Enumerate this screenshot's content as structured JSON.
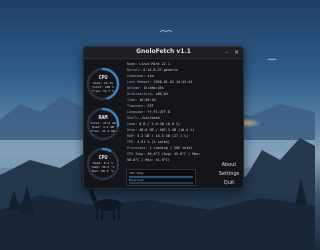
{
  "window": {
    "title": "GnoloFetch v1.1",
    "minimize_label": "–",
    "close_label": "✕"
  },
  "gauges": [
    {
      "title": "CPU",
      "lines": [
        "Used: 45.3%",
        "Total: 100 %",
        "Free: 54.7 %"
      ],
      "value": 0.45,
      "color": "#3b82c4"
    },
    {
      "title": "RAM",
      "lines": [
        "Total: 15.5 GB",
        "Used: 4.2 GB",
        "Free: 11.3 GB"
      ],
      "value": 0.27,
      "color": "#3b82c4"
    },
    {
      "title": "CPU",
      "lines": [
        "Used: 8.1 %",
        "Temp: 46.0 °C",
        "Max: 80.0 °C"
      ],
      "value": 0.08,
      "color": "#3b82c4"
    }
  ],
  "info": [
    {
      "key": "Name:",
      "value": "Linux Mint 22.1"
    },
    {
      "key": "Kernel:",
      "value": "6.14.0-37-generic"
    },
    {
      "key": "Codename:",
      "value": "xia"
    },
    {
      "key": "Last Reboot:",
      "value": "2026-01-02 14:45:44"
    },
    {
      "key": "Uptime:",
      "value": "1h:46m:45s"
    },
    {
      "key": "Architecture:",
      "value": "x86_64"
    },
    {
      "key": "Time:",
      "value": "16:36:26"
    },
    {
      "key": "Timezone:",
      "value": "EST"
    },
    {
      "key": "Language:",
      "value": "fr_FI.UTF-8"
    },
    {
      "key": "Shell:",
      "value": "/bin/bash"
    },
    {
      "key": "Swap:",
      "value": "0 B / 2.0 GB (0.0 %)"
    },
    {
      "key": "Disk:",
      "value": "48.6 GB / 467.3 GB (10.4 %)"
    },
    {
      "key": "RAM:",
      "value": "4.2 GB / 15.5 GB (27.1 %)"
    },
    {
      "key": "CPU:",
      "value": "4.91 % (2 cores)"
    },
    {
      "key": "Processes:",
      "value": "1 running / 285 total"
    },
    {
      "key": "CPU Temp:",
      "value": "46.0°C (Avg: 45.6°C / Max:"
    },
    {
      "key": "",
      "value": "50.0°C / Min: 41.0°C)"
    }
  ],
  "graph": {
    "label_top": "CPU Temp",
    "label_bottom": "Download"
  },
  "side_buttons": {
    "about": "About",
    "settings": "Settings",
    "quit": "Quit"
  }
}
